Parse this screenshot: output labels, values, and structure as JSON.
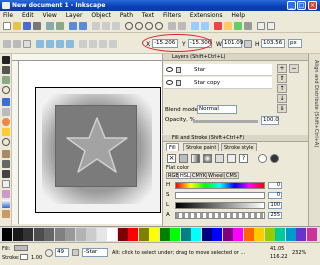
{
  "window": {
    "title": "New document 1 - Inkscape",
    "minimize": "_",
    "maximize": "□",
    "close": "×"
  },
  "menu": [
    "File",
    "Edit",
    "View",
    "Layer",
    "Object",
    "Path",
    "Text",
    "Filters",
    "Extensions",
    "Help"
  ],
  "controls": {
    "x_label": "X",
    "x_value": "-15.206",
    "y_label": "Y",
    "y_value": "-15.306",
    "w_label": "W",
    "w_value": "101.09",
    "h_label": "H",
    "h_value": "103.56",
    "unit": "px"
  },
  "layers_dock": {
    "title": "Layers (Shift+Ctrl+L)",
    "rows": [
      {
        "name": "Star"
      },
      {
        "name": "Star copy"
      }
    ],
    "blend_label": "Blend mode:",
    "blend_value": "Normal",
    "opacity_label": "Opacity, %",
    "opacity_value": "100.0"
  },
  "fill_stroke_dock": {
    "title": "Fill and Stroke (Shift+Ctrl+F)",
    "tabs": [
      "Fill",
      "Stroke paint",
      "Stroke style"
    ],
    "flat_color_label": "Flat color",
    "mode_tabs": [
      "RGB",
      "HSL",
      "CMYK",
      "Wheel",
      "CMS"
    ],
    "sliders": [
      {
        "label": "H",
        "value": "0"
      },
      {
        "label": "S",
        "value": "0"
      },
      {
        "label": "L",
        "value": "100"
      },
      {
        "label": "A",
        "value": "255"
      }
    ]
  },
  "right_tabs": [
    "Align and Distribute (Shift+Ctrl+A)"
  ],
  "statusbar": {
    "fill_label": "Fill:",
    "stroke_label": "Stroke:",
    "stroke_width": "1.00",
    "opacity_value": "49",
    "layer": "-Star",
    "message": "Alt: click to select under; drag to move selected or ...",
    "cursor_x": "41.05",
    "cursor_y": "116.22",
    "zoom": "232%"
  },
  "palette_colors": [
    "#000000",
    "#1a1a1a",
    "#333333",
    "#4d4d4d",
    "#666666",
    "#808080",
    "#999999",
    "#b3b3b3",
    "#cccccc",
    "#e6e6e6",
    "#ffffff",
    "#800000",
    "#ff0000",
    "#808000",
    "#ffff00",
    "#008000",
    "#00ff00",
    "#008080",
    "#00ffff",
    "#000080",
    "#0000ff",
    "#800080",
    "#ff00ff",
    "#ff6600",
    "#ffcc00",
    "#99cc00",
    "#00cc99",
    "#0099cc",
    "#6633cc",
    "#cc3399"
  ],
  "accent": {
    "title_blue": "#0a3fb8",
    "highlight": "#d8262b"
  }
}
